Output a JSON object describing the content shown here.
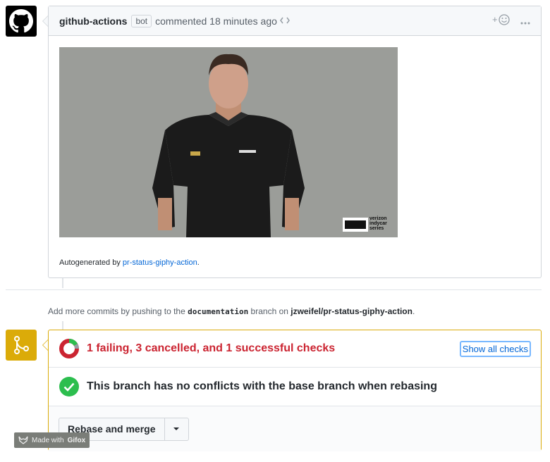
{
  "comment": {
    "author": "github-actions",
    "badge": "bot",
    "action": "commented 18 minutes ago",
    "reaction_icon": "smiley-icon",
    "more_icon": "kebab-horizontal-icon",
    "autogen_prefix": "Autogenerated by",
    "autogen_link": "pr-status-giphy-action",
    "autogen_suffix": ".",
    "gif_logo_lines": [
      "verizon",
      "indycar",
      "series"
    ]
  },
  "push_hint": {
    "prefix": "Add more commits by pushing to the",
    "branch": "documentation",
    "middle": "branch on",
    "repo": "jzweifel/pr-status-giphy-action",
    "suffix": "."
  },
  "merge": {
    "checks_status": "1 failing, 3 cancelled, and 1 successful checks",
    "show_checks": "Show all checks",
    "conflict_status": "This branch has no conflicts with the base branch when rebasing",
    "merge_button": "Rebase and merge"
  },
  "watermark": {
    "prefix": "Made with",
    "brand": "Gifox"
  },
  "colors": {
    "fail": "#cb2431",
    "success": "#2cbe4e",
    "warning": "#dbab09",
    "link": "#0366d6"
  }
}
